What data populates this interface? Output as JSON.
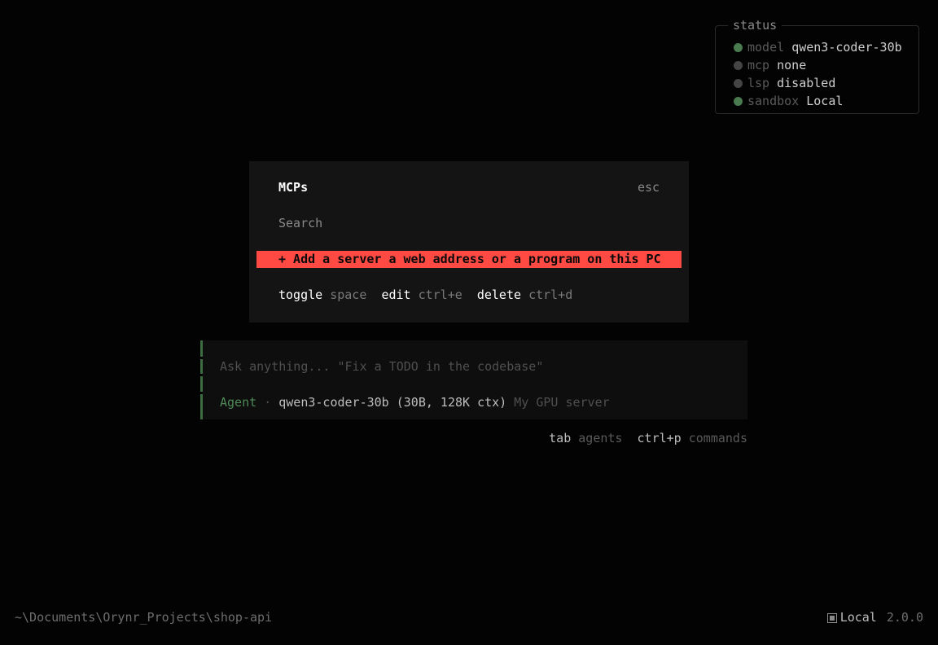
{
  "status": {
    "title": "status",
    "rows": [
      {
        "key": "model",
        "value": "qwen3-coder-30b",
        "dot_color": "#4a7a4f"
      },
      {
        "key": "mcp",
        "value": "none",
        "dot_color": "#454545"
      },
      {
        "key": "lsp",
        "value": "disabled",
        "dot_color": "#454545"
      },
      {
        "key": "sandbox",
        "value": "Local",
        "dot_color": "#4a7a4f"
      }
    ]
  },
  "dialog": {
    "title": "MCPs",
    "close_label": "esc",
    "search_placeholder": "Search",
    "add_item": "+ Add a server a web address or a program on this PC",
    "hints": [
      {
        "key": "toggle",
        "desc": "space"
      },
      {
        "key": "edit",
        "desc": "ctrl+e"
      },
      {
        "key": "delete",
        "desc": "ctrl+d"
      }
    ]
  },
  "prompt": {
    "placeholder": "Ask anything... \"Fix a TODO in the codebase\"",
    "agent_mode": "Agent",
    "separator": "·",
    "model": "qwen3-coder-30b (30B, 128K ctx)",
    "provider": "My GPU server"
  },
  "shortcuts": [
    {
      "key": "tab",
      "desc": "agents"
    },
    {
      "key": "ctrl+p",
      "desc": "commands"
    }
  ],
  "footer": {
    "cwd": "~\\Documents\\Orynr_Projects\\shop-api",
    "mode": "Local",
    "version": "2.0.0"
  },
  "colors": {
    "background": "#030303",
    "accent_red": "#ff4a44",
    "accent_green": "#4f8a57"
  }
}
